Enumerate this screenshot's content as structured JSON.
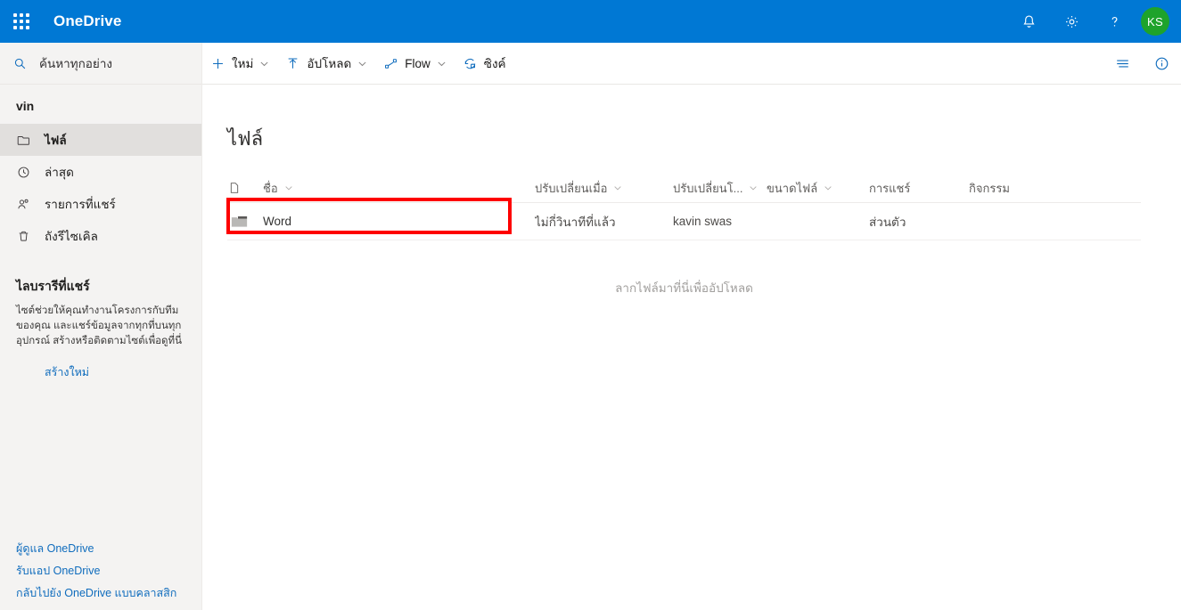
{
  "header": {
    "waffle_label": "app-launcher",
    "brand": "OneDrive",
    "icons": [
      {
        "name": "notifications-icon",
        "label": "การแจ้งเตือน"
      },
      {
        "name": "settings-gear-icon",
        "label": "การตั้งค่า"
      },
      {
        "name": "help-icon",
        "label": "วิธีใช้"
      }
    ],
    "avatar_initials": "KS",
    "brand_color": "#0078d4",
    "avatar_color": "#1ea32b"
  },
  "search": {
    "placeholder": "ค้นหาทุกอย่าง",
    "icon": "search-icon"
  },
  "sidebar": {
    "account_name": "vin",
    "items": [
      {
        "label": "ไฟล์",
        "icon": "folder-icon",
        "selected": true
      },
      {
        "label": "ล่าสุด",
        "icon": "clock-history-icon",
        "selected": false
      },
      {
        "label": "รายการที่แชร์",
        "icon": "people-shared-icon",
        "selected": false
      },
      {
        "label": "ถังรีไซเคิล",
        "icon": "recycle-bin-icon",
        "selected": false
      }
    ],
    "shared_libraries": {
      "title": "ไลบรารีที่แชร์",
      "description": "ไซต์ช่วยให้คุณทำงานโครงการกับทีมของคุณ และแชร์ข้อมูลจากทุกที่บนทุกอุปกรณ์ สร้างหรือติดตามไซต์เพื่อดูที่นี่",
      "create_link": "สร้างใหม่"
    },
    "footer_links": [
      "ผู้ดูแล OneDrive",
      "รับแอป OneDrive",
      "กลับไปยัง OneDrive แบบคลาสสิก"
    ]
  },
  "commandbar": {
    "items": [
      {
        "label": "ใหม่",
        "icon": "plus-icon",
        "has_chevron": true
      },
      {
        "label": "อัปโหลด",
        "icon": "upload-arrow-icon",
        "has_chevron": true
      },
      {
        "label": "Flow",
        "icon": "flow-icon",
        "has_chevron": true
      },
      {
        "label": "ซิงค์",
        "icon": "sync-icon",
        "has_chevron": false
      }
    ],
    "right_icons": [
      {
        "name": "list-view-icon",
        "label": "มุมมองรายการ"
      },
      {
        "name": "info-icon",
        "label": "ข้อมูล"
      }
    ]
  },
  "main": {
    "page_title": "ไฟล์",
    "dropzone_text": "ลากไฟล์มาที่นี่เพื่ออัปโหลด",
    "columns": [
      {
        "key": "name",
        "label": "ชื่อ",
        "sortable": true
      },
      {
        "key": "modified",
        "label": "ปรับเปลี่ยนเมื่อ",
        "sortable": true
      },
      {
        "key": "modified_by",
        "label": "ปรับเปลี่ยนโ...",
        "sortable": true
      },
      {
        "key": "size",
        "label": "ขนาดไฟล์",
        "sortable": true
      },
      {
        "key": "sharing",
        "label": "การแชร์",
        "sortable": false
      },
      {
        "key": "activity",
        "label": "กิจกรรม",
        "sortable": false
      }
    ],
    "rows": [
      {
        "name": "Word",
        "icon": "folder-icon",
        "is_new": true,
        "modified": "ไม่กี่วินาทีที่แล้ว",
        "modified_by": "kavin swas",
        "size": "",
        "sharing": "ส่วนตัว",
        "activity": ""
      }
    ]
  },
  "annotation": {
    "highlight_color": "#fe0000",
    "target": "row-word"
  }
}
